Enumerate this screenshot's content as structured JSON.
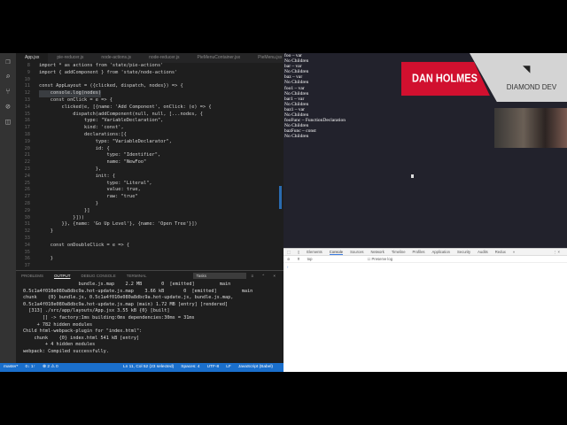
{
  "editor": {
    "tabs": [
      "App.jsx",
      "pie-reducer.js",
      "node-actions.js",
      "node-reducer.js",
      "PieMenuContainer.jsx",
      "PieMenu.jsx"
    ],
    "active_tab": "App.jsx",
    "lines": [
      {
        "n": "8",
        "t": "import * as actions from 'state/pie-actions'"
      },
      {
        "n": "9",
        "t": "import { addComponent } from 'state/node-actions'"
      },
      {
        "n": "10",
        "t": ""
      },
      {
        "n": "11",
        "t": "const AppLayout = ({clicked, dispatch, nodes}) => {"
      },
      {
        "n": "12",
        "t": "    console.log(nodes)"
      },
      {
        "n": "13",
        "t": "    const onClick = e => {"
      },
      {
        "n": "14",
        "t": "        clicked(e, [{name: 'Add Component', onClick: (e) => {"
      },
      {
        "n": "15",
        "t": "            dispatch(addComponent(null, null, [...nodes, {"
      },
      {
        "n": "16",
        "t": "                type: \"VariableDeclaration\","
      },
      {
        "n": "17",
        "t": "                kind: 'const',"
      },
      {
        "n": "18",
        "t": "                declarations:[{"
      },
      {
        "n": "19",
        "t": "                    type: \"VariableDeclarator\","
      },
      {
        "n": "20",
        "t": "                    id: {"
      },
      {
        "n": "21",
        "t": "                        type: \"Identifier\","
      },
      {
        "n": "22",
        "t": "                        name: \"NewFoo\""
      },
      {
        "n": "23",
        "t": "                    },"
      },
      {
        "n": "24",
        "t": "                    init: {"
      },
      {
        "n": "25",
        "t": "                        type: \"Literal\","
      },
      {
        "n": "26",
        "t": "                        value: true,"
      },
      {
        "n": "27",
        "t": "                        raw: \"true\""
      },
      {
        "n": "28",
        "t": "                    }"
      },
      {
        "n": "29",
        "t": "                }]"
      },
      {
        "n": "30",
        "t": "            }]))"
      },
      {
        "n": "31",
        "t": "        }}, {name: 'Go Up Level'}, {name: 'Open Tree'}])"
      },
      {
        "n": "32",
        "t": "    }"
      },
      {
        "n": "33",
        "t": ""
      },
      {
        "n": "34",
        "t": "    const onDoubleClick = e => {"
      },
      {
        "n": "35",
        "t": ""
      },
      {
        "n": "36",
        "t": "    }"
      },
      {
        "n": "37",
        "t": ""
      }
    ]
  },
  "panel": {
    "tabs": [
      "PROBLEMS",
      "OUTPUT",
      "DEBUG CONSOLE",
      "TERMINAL"
    ],
    "active_tab": "OUTPUT",
    "task_select": "Tasks",
    "output": [
      "                    bundle.js.map    2.2 MB       0  [emitted]         main",
      "0.5c1a4f010e080a8dbc9a.hot-update.js.map    3.66 kB       0  [emitted]         main",
      "chunk    {0} bundle.js, 0.5c1a4f010e080a8dbc9a.hot-update.js, bundle.js.map,",
      "0.5c1a4f010e080a8dbc9a.hot-update.js.map (main) 1.72 MB [entry] [rendered]",
      "  [313] ./src/app/layouts/App.jsx 3.55 kB {0} [built]",
      "       [] -> factory:1ms building:0ms dependencies:30ms = 31ms",
      "     + 782 hidden modules",
      "Child html-webpack-plugin for \"index.html\":",
      "    chunk    {0} index.html 541 kB [entry]",
      "        + 4 hidden modules",
      "webpack: Compiled successfully."
    ]
  },
  "status": {
    "branch": "master*",
    "sync": "0↓ 1↑",
    "problems": "⊗ 2 ⚠ 0",
    "position": "Ln 11, Col 52 (23 selected)",
    "spaces": "Spaces: 4",
    "encoding": "UTF-8",
    "eol": "LF",
    "language": "JavaScript (Babel)"
  },
  "browser": {
    "output": [
      "foo – var",
      "No Children",
      "bar – var",
      "No Children",
      "baz – var",
      "No Children",
      "foo1 – var",
      "No Children",
      "bar1 – var",
      "No Children",
      "baz1 – var",
      "No Children",
      "fooFunc – FunctionDeclaration",
      "No Children",
      "bazFunc – const",
      "No Children"
    ],
    "devtools_tabs": [
      "Elements",
      "Console",
      "Sources",
      "Network",
      "Timeline",
      "Profiles",
      "Application",
      "Security",
      "Audits",
      "Redux",
      "»"
    ],
    "devtools_active": "Console",
    "context": "top",
    "preserve_log": "Preserve log",
    "prompt": "›"
  },
  "overlay": {
    "name": "DAN HOLMES",
    "brand": "DIAMOND DEV"
  }
}
